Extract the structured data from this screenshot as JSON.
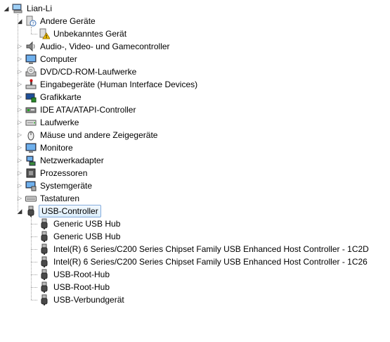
{
  "root": {
    "label": "Lian-Li",
    "icon": "computer-root-icon",
    "expanded": true
  },
  "categories": [
    {
      "label": "Andere Geräte",
      "icon": "unknown-device-category-icon",
      "expanded": true,
      "children": [
        {
          "label": "Unbekanntes Gerät",
          "icon": "warning-device-icon"
        }
      ]
    },
    {
      "label": "Audio-, Video- und Gamecontroller",
      "icon": "speaker-icon",
      "expanded": false
    },
    {
      "label": "Computer",
      "icon": "monitor-icon",
      "expanded": false
    },
    {
      "label": "DVD/CD-ROM-Laufwerke",
      "icon": "dvd-drive-icon",
      "expanded": false
    },
    {
      "label": "Eingabegeräte (Human Interface Devices)",
      "icon": "hid-icon",
      "expanded": false
    },
    {
      "label": "Grafikkarte",
      "icon": "display-adapter-icon",
      "expanded": false
    },
    {
      "label": "IDE ATA/ATAPI-Controller",
      "icon": "ide-controller-icon",
      "expanded": false
    },
    {
      "label": "Laufwerke",
      "icon": "disk-drive-icon",
      "expanded": false
    },
    {
      "label": "Mäuse und andere Zeigegeräte",
      "icon": "mouse-icon",
      "expanded": false
    },
    {
      "label": "Monitore",
      "icon": "monitor-icon",
      "expanded": false
    },
    {
      "label": "Netzwerkadapter",
      "icon": "network-adapter-icon",
      "expanded": false
    },
    {
      "label": "Prozessoren",
      "icon": "processor-icon",
      "expanded": false
    },
    {
      "label": "Systemgeräte",
      "icon": "system-devices-icon",
      "expanded": false
    },
    {
      "label": "Tastaturen",
      "icon": "keyboard-icon",
      "expanded": false
    },
    {
      "label": "USB-Controller",
      "icon": "usb-plug-icon",
      "expanded": true,
      "selected": true,
      "children": [
        {
          "label": "Generic USB Hub",
          "icon": "usb-plug-icon"
        },
        {
          "label": "Generic USB Hub",
          "icon": "usb-plug-icon"
        },
        {
          "label": "Intel(R) 6 Series/C200 Series Chipset Family USB Enhanced Host Controller - 1C2D",
          "icon": "usb-plug-icon"
        },
        {
          "label": "Intel(R) 6 Series/C200 Series Chipset Family USB Enhanced Host Controller - 1C26",
          "icon": "usb-plug-icon"
        },
        {
          "label": "USB-Root-Hub",
          "icon": "usb-plug-icon"
        },
        {
          "label": "USB-Root-Hub",
          "icon": "usb-plug-icon"
        },
        {
          "label": "USB-Verbundgerät",
          "icon": "usb-plug-icon"
        }
      ]
    }
  ]
}
